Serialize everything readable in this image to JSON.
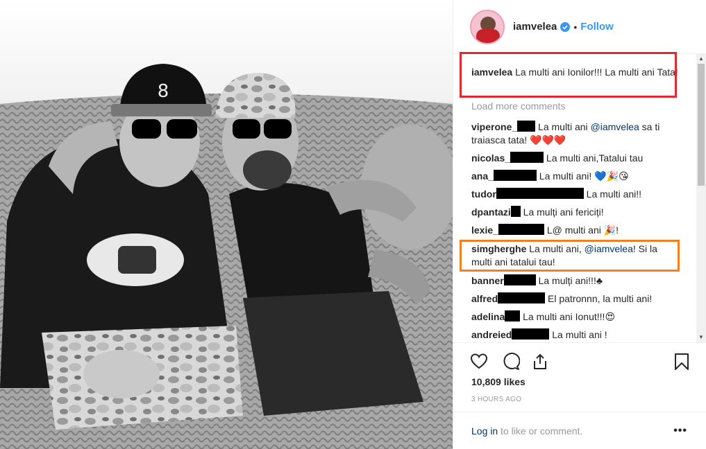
{
  "post": {
    "username": "iamvelea",
    "follow_label": "Follow",
    "separator": "•"
  },
  "caption": {
    "username": "iamvelea",
    "text": "La multi ani Ionilor!!! La multi ani Tata!"
  },
  "load_more": "Load more comments",
  "comments": [
    {
      "user": "viperone_",
      "text": " La multi ani ",
      "mention": "@iamvelea",
      "after": " sa ti traiasca tata! ",
      "emoji": "❤️❤️❤️"
    },
    {
      "user": "nicolas_",
      "text": " La multi ani,Tatalui tau"
    },
    {
      "user": "ana_",
      "text": " La multi ani! ",
      "emoji": "💙🎉😘"
    },
    {
      "user": "tudor",
      "text": " La multi ani!!"
    },
    {
      "user": "dpantazi",
      "text": " La mulți ani fericiți!"
    },
    {
      "user": "lexie_",
      "text": " L@ multi ani ",
      "emoji": "🎉!"
    },
    {
      "user": "simgherghe",
      "text": " La multi ani, ",
      "mention": "@iamvelea",
      "after": "! Si la multi ani tatalui tau!"
    },
    {
      "user": "banner",
      "text": " La mulți ani!!!",
      "emoji": "♣"
    },
    {
      "user": "alfred",
      "text": " El patronnn, la multi ani!"
    },
    {
      "user": "adelina",
      "text": " La multi ani Ionut!!!",
      "emoji": "😍"
    },
    {
      "user": "andreied",
      "text": " La multi ani !"
    }
  ],
  "likes": "10,809 likes",
  "timestamp": "3 HOURS AGO",
  "login": {
    "link": "Log in",
    "rest": " to like or comment."
  },
  "more_label": "•••",
  "icons": [
    "heart-icon",
    "comment-icon",
    "share-icon",
    "bookmark-icon",
    "verified-icon"
  ],
  "colors": {
    "follow": "#3897f0",
    "mention": "#003569",
    "highlight_red": "#e0282d",
    "highlight_orange": "#f08020"
  }
}
